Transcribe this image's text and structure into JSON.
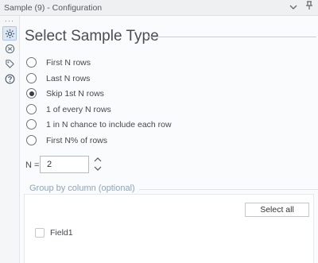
{
  "window": {
    "title": "Sample (9) - Configuration"
  },
  "side_icons": [
    "gear-icon",
    "cube-icon",
    "tag-icon",
    "help-icon"
  ],
  "heading": "Select Sample Type",
  "options": [
    {
      "label": "First N rows",
      "checked": false
    },
    {
      "label": "Last N rows",
      "checked": false
    },
    {
      "label": "Skip 1st N rows",
      "checked": true
    },
    {
      "label": "1 of every N rows",
      "checked": false
    },
    {
      "label": "1 in N chance to include each row",
      "checked": false
    },
    {
      "label": "First N% of rows",
      "checked": false
    }
  ],
  "n_field": {
    "label": "N =",
    "value": "2"
  },
  "group": {
    "label": "Group by column (optional)",
    "select_all_label": "Select all",
    "fields": [
      {
        "label": "Field1",
        "checked": false
      }
    ]
  }
}
